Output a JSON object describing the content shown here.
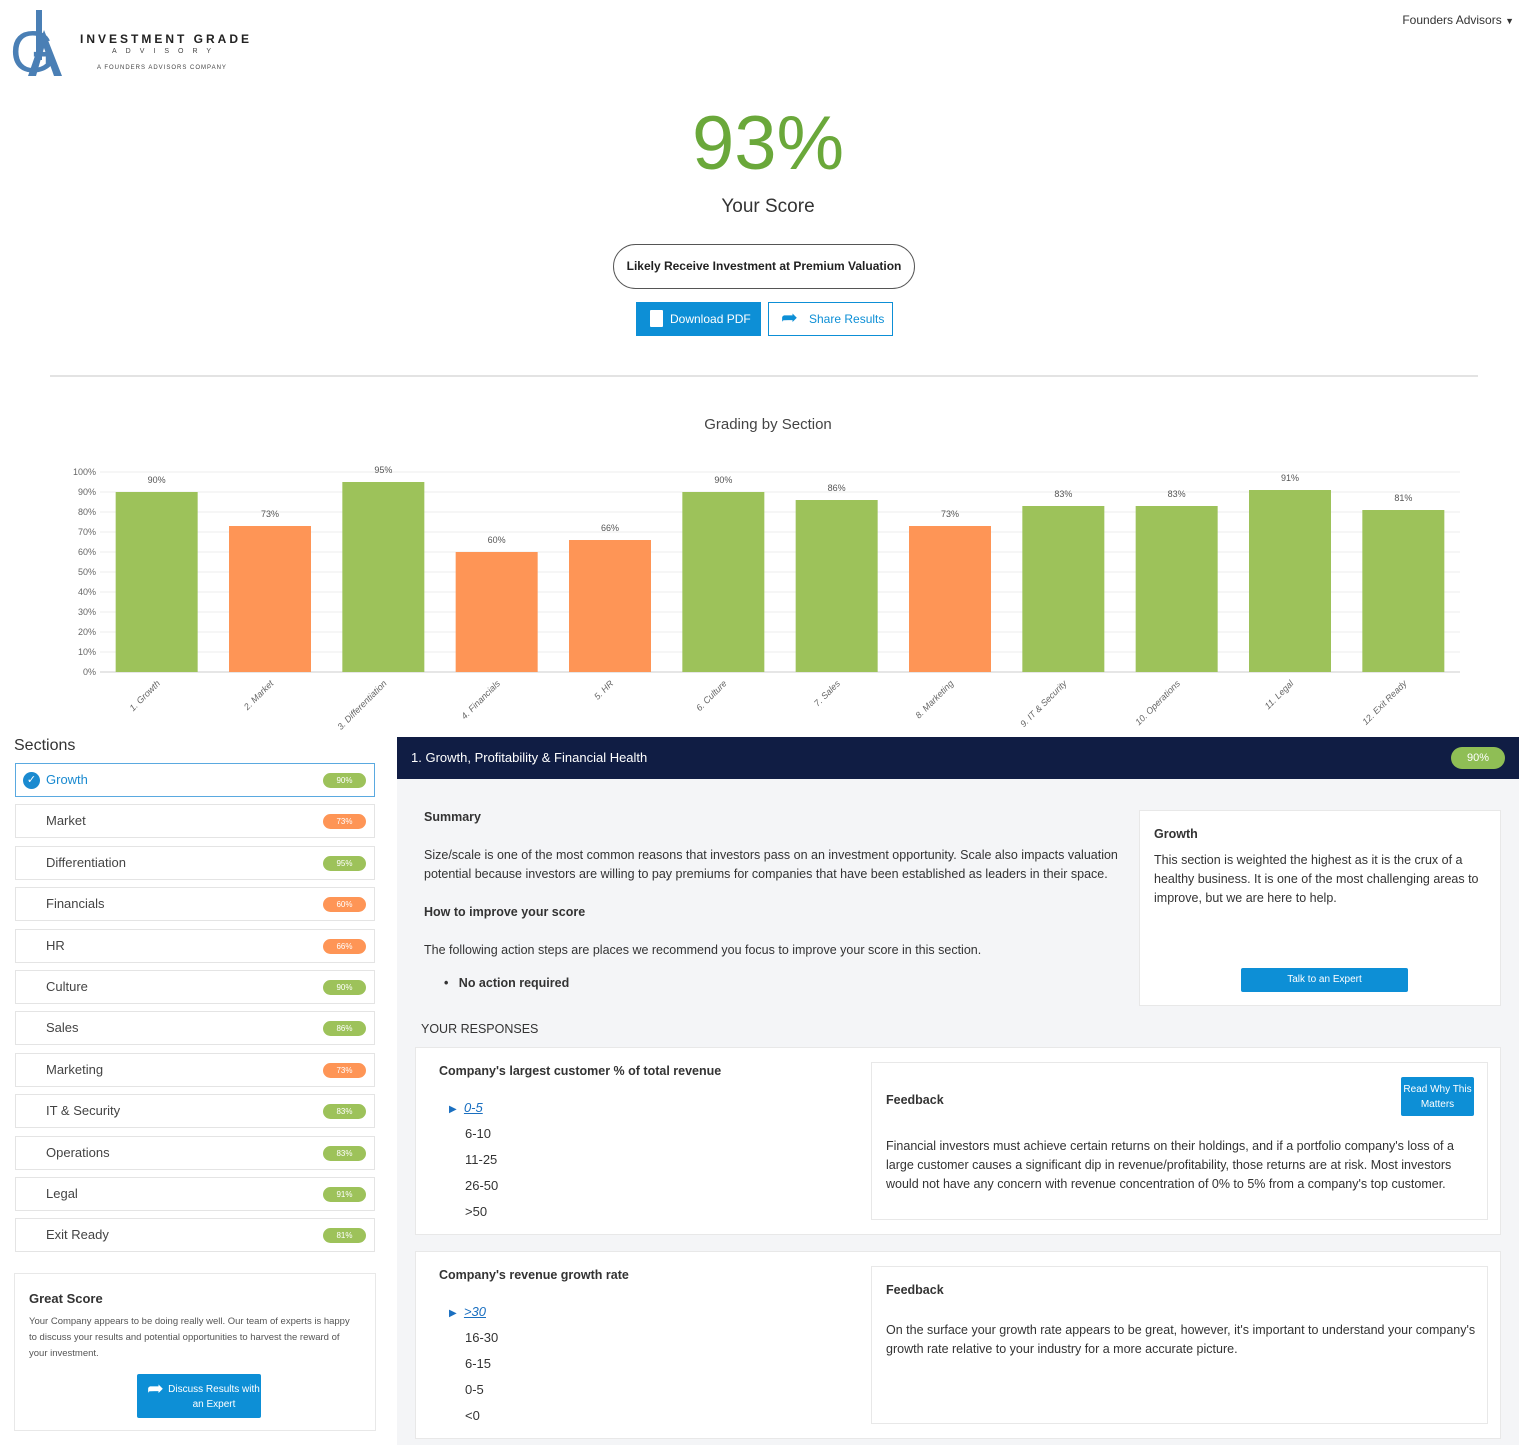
{
  "header": {
    "logo_text": "INVESTMENT GRADE",
    "logo_sub": "ADVISORY",
    "logo_tag": "A FOUNDERS ADVISORS COMPANY",
    "user_menu": "Founders Advisors"
  },
  "score": {
    "value": "93%",
    "label": "Your Score",
    "verdict": "Likely Receive Investment at Premium Valuation",
    "download_label": "Download PDF",
    "share_label": "Share Results"
  },
  "colors": {
    "good": "#9dc25a",
    "warn": "#fe9556",
    "primary": "#0d8fd6",
    "header": "#101d44",
    "score": "#6aa83a"
  },
  "chart_data": {
    "type": "bar",
    "title": "Grading by Section",
    "categories": [
      "1. Growth",
      "2. Market",
      "3. Differentiation",
      "4. Financials",
      "5. HR",
      "6. Culture",
      "7. Sales",
      "8. Marketing",
      "9. IT & Security",
      "10. Operations",
      "11. Legal",
      "12. Exit Ready"
    ],
    "values": [
      90,
      73,
      95,
      60,
      66,
      90,
      86,
      73,
      83,
      83,
      91,
      81
    ],
    "value_labels": [
      "90%",
      "73%",
      "95%",
      "60%",
      "66%",
      "90%",
      "86%",
      "73%",
      "83%",
      "83%",
      "91%",
      "81%"
    ],
    "ylim": [
      0,
      100
    ],
    "yticks": [
      "0%",
      "10%",
      "20%",
      "30%",
      "40%",
      "50%",
      "60%",
      "70%",
      "80%",
      "90%",
      "100%"
    ],
    "grid": true,
    "bar_colors": [
      "#9dc25a",
      "#fe9556",
      "#9dc25a",
      "#fe9556",
      "#fe9556",
      "#9dc25a",
      "#9dc25a",
      "#fe9556",
      "#9dc25a",
      "#9dc25a",
      "#9dc25a",
      "#9dc25a"
    ]
  },
  "sections": {
    "title": "Sections",
    "items": [
      {
        "label": "Growth",
        "score": "90%",
        "status": "good",
        "active": true
      },
      {
        "label": "Market",
        "score": "73%",
        "status": "warn"
      },
      {
        "label": "Differentiation",
        "score": "95%",
        "status": "good"
      },
      {
        "label": "Financials",
        "score": "60%",
        "status": "warn"
      },
      {
        "label": "HR",
        "score": "66%",
        "status": "warn"
      },
      {
        "label": "Culture",
        "score": "90%",
        "status": "good"
      },
      {
        "label": "Sales",
        "score": "86%",
        "status": "good"
      },
      {
        "label": "Marketing",
        "score": "73%",
        "status": "warn"
      },
      {
        "label": "IT & Security",
        "score": "83%",
        "status": "good"
      },
      {
        "label": "Operations",
        "score": "83%",
        "status": "good"
      },
      {
        "label": "Legal",
        "score": "91%",
        "status": "good"
      },
      {
        "label": "Exit Ready",
        "score": "81%",
        "status": "good"
      }
    ]
  },
  "great_score": {
    "title": "Great Score",
    "text": "Your Company appears to be doing really well. Our team of experts is happy to discuss your results and potential opportunities to harvest the reward of your investment.",
    "button": "Discuss Results with an Expert"
  },
  "detail": {
    "title": "1. Growth, Profitability & Financial Health",
    "score": "90%",
    "summary_title": "Summary",
    "summary": "Size/scale is one of the most common reasons that investors pass on an investment opportunity. Scale also impacts valuation potential because investors are willing to pay premiums for companies that have been established as leaders in their space.",
    "improve_title": "How to improve your score",
    "improve_text": "The following action steps are places we recommend you focus to improve your score in this section.",
    "actions": [
      "No action required"
    ],
    "side_title": "Growth",
    "side_text": "This section is weighted the highest as it is the crux of a healthy business. It is one of the most challenging areas to improve, but we are here to help.",
    "side_button": "Talk to an Expert",
    "responses_title": "YOUR RESPONSES",
    "questions": [
      {
        "question": "Company's largest customer % of total revenue",
        "options": [
          "0-5",
          "6-10",
          "11-25",
          "26-50",
          ">50"
        ],
        "selected": "0-5",
        "feedback_title": "Feedback",
        "read_why": "Read Why This Matters",
        "feedback": "Financial investors must achieve certain returns on their holdings, and if a portfolio company's loss of a large customer causes a significant dip in revenue/profitability, those returns are at risk. Most investors would not have any concern with revenue concentration of 0% to 5% from a company's top customer."
      },
      {
        "question": "Company's revenue growth rate",
        "options": [
          ">30",
          "16-30",
          "6-15",
          "0-5",
          "<0"
        ],
        "selected": ">30",
        "feedback_title": "Feedback",
        "feedback": "On the surface your growth rate appears to be great, however, it's important to understand your company's growth rate relative to your industry for a more accurate picture."
      }
    ]
  }
}
